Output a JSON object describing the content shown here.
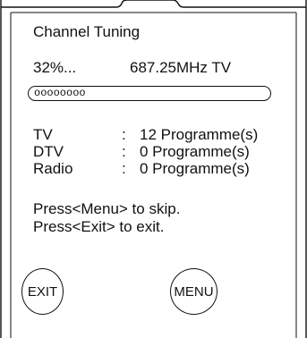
{
  "screen": {
    "title": "Channel Tuning",
    "progress_text": "32%...",
    "frequency_text": "687.25MHz TV",
    "progress_fraction": 0.32,
    "progress_glyphs": "oooooooo"
  },
  "results": [
    {
      "label": "TV",
      "separator": ":",
      "value": "12 Programme(s)"
    },
    {
      "label": "DTV",
      "separator": ":",
      "value": "0 Programme(s)"
    },
    {
      "label": "Radio",
      "separator": ":",
      "value": "0 Programme(s)"
    }
  ],
  "instructions": {
    "menu_line": "Press<Menu> to skip.",
    "exit_line": "Press<Exit> to exit."
  },
  "buttons": {
    "exit_label": "EXIT",
    "menu_label": "MENU"
  }
}
